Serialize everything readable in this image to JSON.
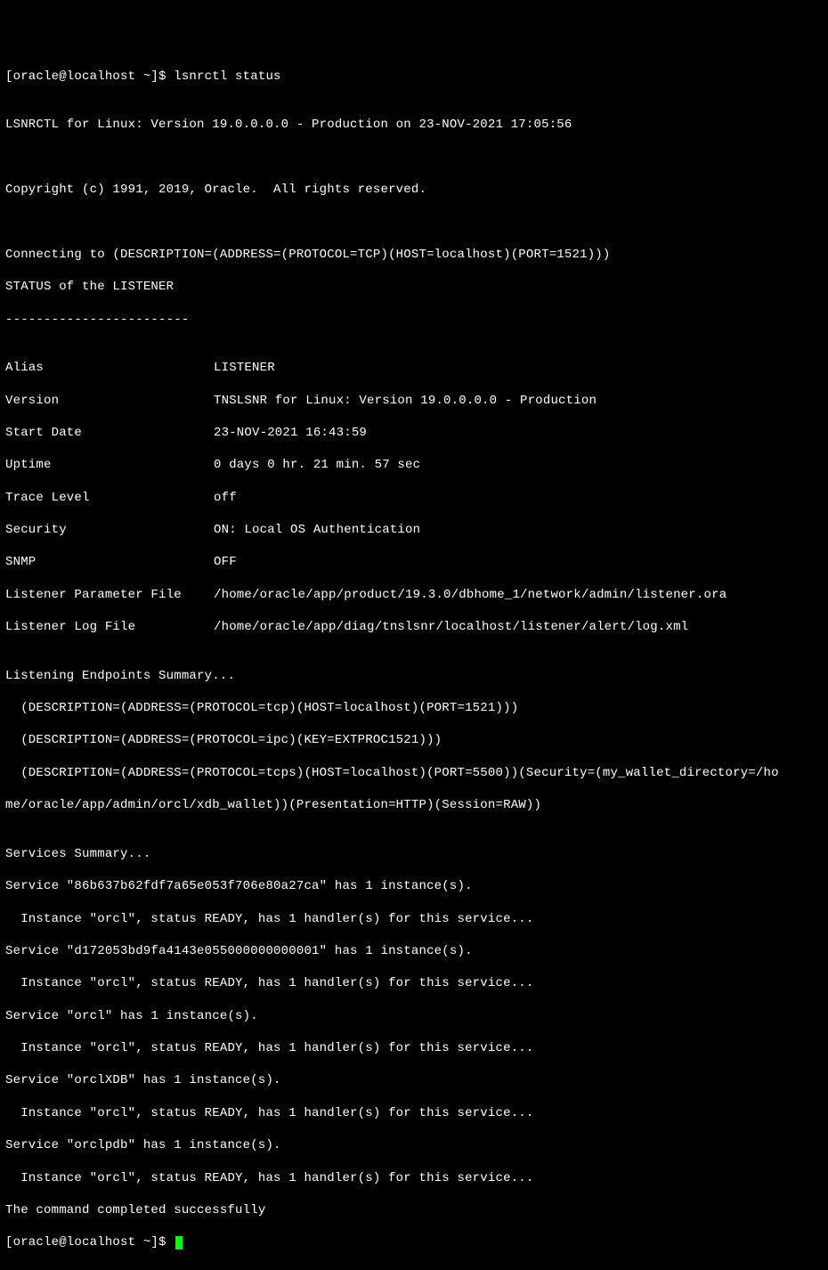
{
  "prompt1": "[oracle@localhost ~]$ ",
  "command": "lsnrctl status",
  "blank": "",
  "header_line1": "LSNRCTL for Linux: Version 19.0.0.0.0 - Production on 23-NOV-2021 17:05:56",
  "copyright": "Copyright (c) 1991, 2019, Oracle.  All rights reserved.",
  "connecting": "Connecting to (DESCRIPTION=(ADDRESS=(PROTOCOL=TCP)(HOST=localhost)(PORT=1521)))",
  "status_header": "STATUS of the LISTENER",
  "dashes": "------------------------",
  "fields": {
    "alias_label": "Alias",
    "alias_value": "LISTENER",
    "version_label": "Version",
    "version_value": "TNSLSNR for Linux: Version 19.0.0.0.0 - Production",
    "startdate_label": "Start Date",
    "startdate_value": "23-NOV-2021 16:43:59",
    "uptime_label": "Uptime",
    "uptime_value": "0 days 0 hr. 21 min. 57 sec",
    "tracelevel_label": "Trace Level",
    "tracelevel_value": "off",
    "security_label": "Security",
    "security_value": "ON: Local OS Authentication",
    "snmp_label": "SNMP",
    "snmp_value": "OFF",
    "paramfile_label": "Listener Parameter File",
    "paramfile_value": "/home/oracle/app/product/19.3.0/dbhome_1/network/admin/listener.ora",
    "logfile_label": "Listener Log File",
    "logfile_value": "/home/oracle/app/diag/tnslsnr/localhost/listener/alert/log.xml"
  },
  "endpoints_header": "Listening Endpoints Summary...",
  "endpoint1": "  (DESCRIPTION=(ADDRESS=(PROTOCOL=tcp)(HOST=localhost)(PORT=1521)))",
  "endpoint2": "  (DESCRIPTION=(ADDRESS=(PROTOCOL=ipc)(KEY=EXTPROC1521)))",
  "endpoint3a": "  (DESCRIPTION=(ADDRESS=(PROTOCOL=tcps)(HOST=localhost)(PORT=5500))(Security=(my_wallet_directory=/ho",
  "endpoint3b": "me/oracle/app/admin/orcl/xdb_wallet))(Presentation=HTTP)(Session=RAW))",
  "services_header": "Services Summary...",
  "svc1": "Service \"86b637b62fdf7a65e053f706e80a27ca\" has 1 instance(s).",
  "svc1_inst": "  Instance \"orcl\", status READY, has 1 handler(s) for this service...",
  "svc2": "Service \"d172053bd9fa4143e055000000000001\" has 1 instance(s).",
  "svc2_inst": "  Instance \"orcl\", status READY, has 1 handler(s) for this service...",
  "svc3": "Service \"orcl\" has 1 instance(s).",
  "svc3_inst": "  Instance \"orcl\", status READY, has 1 handler(s) for this service...",
  "svc4": "Service \"orclXDB\" has 1 instance(s).",
  "svc4_inst": "  Instance \"orcl\", status READY, has 1 handler(s) for this service...",
  "svc5": "Service \"orclpdb\" has 1 instance(s).",
  "svc5_inst": "  Instance \"orcl\", status READY, has 1 handler(s) for this service...",
  "completed": "The command completed successfully",
  "prompt2": "[oracle@localhost ~]$ "
}
